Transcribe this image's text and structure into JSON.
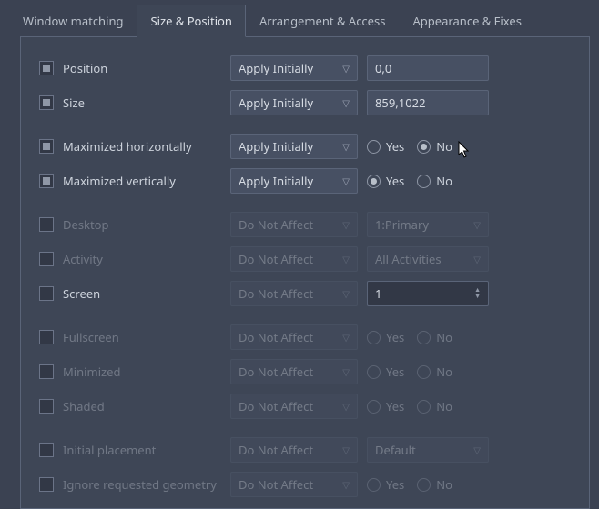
{
  "tabs": {
    "window_matching": "Window matching",
    "size_position": "Size & Position",
    "arrangement_access": "Arrangement & Access",
    "appearance_fixes": "Appearance & Fixes"
  },
  "apply_initially": "Apply Initially",
  "do_not_affect": "Do Not Affect",
  "yes": "Yes",
  "no": "No",
  "rows": {
    "position": {
      "label": "Position",
      "value": "0,0"
    },
    "size": {
      "label": "Size",
      "value": "859,1022"
    },
    "max_h": {
      "label": "Maximized horizontally"
    },
    "max_v": {
      "label": "Maximized vertically"
    },
    "desktop": {
      "label": "Desktop",
      "value": "1:Primary"
    },
    "activity": {
      "label": "Activity",
      "value": "All Activities"
    },
    "screen": {
      "label": "Screen",
      "value": "1"
    },
    "fullscreen": {
      "label": "Fullscreen"
    },
    "minimized": {
      "label": "Minimized"
    },
    "shaded": {
      "label": "Shaded"
    },
    "initial_placement": {
      "label": "Initial placement",
      "value": "Default"
    },
    "ignore_geometry": {
      "label": "Ignore requested geometry"
    }
  }
}
